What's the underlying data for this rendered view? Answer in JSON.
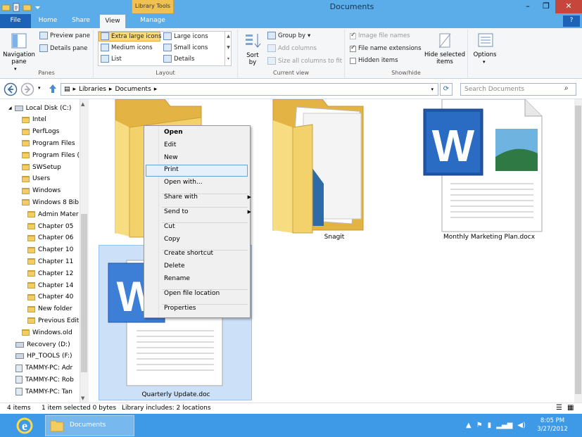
{
  "window": {
    "title": "Documents",
    "context_tab_header": "Library Tools",
    "minimize": "–",
    "maximize": "❐",
    "close": "✕"
  },
  "tabs": {
    "file": "File",
    "home": "Home",
    "share": "Share",
    "view": "View",
    "manage": "Manage",
    "help": "?"
  },
  "ribbon": {
    "panes": {
      "navigation_pane": "Navigation pane",
      "preview_pane": "Preview pane",
      "details_pane": "Details pane",
      "label": "Panes"
    },
    "layout": {
      "extra_large_icons": "Extra large icons",
      "large_icons": "Large icons",
      "medium_icons": "Medium icons",
      "small_icons": "Small icons",
      "list": "List",
      "details": "Details",
      "label": "Layout"
    },
    "current_view": {
      "sort_by": "Sort by",
      "group_by": "Group by",
      "add_columns": "Add columns",
      "size_all_columns": "Size all columns to fit",
      "label": "Current view"
    },
    "show_hide": {
      "image_file_names": "Image file names",
      "file_name_extensions": "File name extensions",
      "hidden_items": "Hidden items",
      "hide_selected_items": "Hide selected items",
      "label": "Show/hide"
    },
    "options": {
      "label": "Options"
    }
  },
  "address": {
    "path": [
      "Libraries",
      "Documents"
    ],
    "search_placeholder": "Search Documents"
  },
  "nav": {
    "items": [
      {
        "label": "Local Disk (C:)",
        "type": "drive",
        "indent": 0
      },
      {
        "label": "Intel",
        "type": "folder",
        "indent": 1
      },
      {
        "label": "PerfLogs",
        "type": "folder",
        "indent": 1
      },
      {
        "label": "Program Files",
        "type": "folder",
        "indent": 1
      },
      {
        "label": "Program Files (",
        "type": "folder",
        "indent": 1
      },
      {
        "label": "SWSetup",
        "type": "folder",
        "indent": 1
      },
      {
        "label": "Users",
        "type": "folder",
        "indent": 1
      },
      {
        "label": "Windows",
        "type": "folder",
        "indent": 1
      },
      {
        "label": "Windows 8 Bib",
        "type": "folder",
        "indent": 1
      },
      {
        "label": "Admin Mater",
        "type": "folder",
        "indent": 2
      },
      {
        "label": "Chapter 05",
        "type": "folder",
        "indent": 2
      },
      {
        "label": "Chapter 06",
        "type": "folder",
        "indent": 2
      },
      {
        "label": "Chapter 10",
        "type": "folder",
        "indent": 2
      },
      {
        "label": "Chapter 11",
        "type": "folder",
        "indent": 2
      },
      {
        "label": "Chapter 12",
        "type": "folder",
        "indent": 2
      },
      {
        "label": "Chapter 14",
        "type": "folder",
        "indent": 2
      },
      {
        "label": "Chapter 40",
        "type": "folder",
        "indent": 2
      },
      {
        "label": "New folder",
        "type": "folder",
        "indent": 2
      },
      {
        "label": "Previous Edit",
        "type": "folder",
        "indent": 2
      },
      {
        "label": "Windows.old",
        "type": "folder",
        "indent": 1
      },
      {
        "label": "Recovery (D:)",
        "type": "drive",
        "indent": 0
      },
      {
        "label": "HP_TOOLS (F:)",
        "type": "drive",
        "indent": 0
      },
      {
        "label": "TAMMY-PC: Adr",
        "type": "pc",
        "indent": 0
      },
      {
        "label": "TAMMY-PC: Rob",
        "type": "pc",
        "indent": 0
      },
      {
        "label": "TAMMY-PC: Tan",
        "type": "pc",
        "indent": 0
      }
    ]
  },
  "files": {
    "snagit": "Snagit",
    "monthly": "Monthly Marketing Plan.docx",
    "quarterly": "Quarterly Update.doc"
  },
  "context_menu": {
    "open": "Open",
    "edit": "Edit",
    "new": "New",
    "print": "Print",
    "open_with": "Open with...",
    "share_with": "Share with",
    "send_to": "Send to",
    "cut": "Cut",
    "copy": "Copy",
    "create_shortcut": "Create shortcut",
    "delete": "Delete",
    "rename": "Rename",
    "open_file_location": "Open file location",
    "properties": "Properties"
  },
  "status": {
    "items": "4 items",
    "selected": "1 item selected  0 bytes",
    "library": "Library includes: 2 locations"
  },
  "taskbar": {
    "app": "Documents",
    "time": "8:05 PM",
    "date": "3/27/2012"
  },
  "colors": {
    "titlebar": "#5badea",
    "file_tab": "#1c63b7",
    "taskbar": "#3e9ae6",
    "selection": "#cce0f7"
  }
}
